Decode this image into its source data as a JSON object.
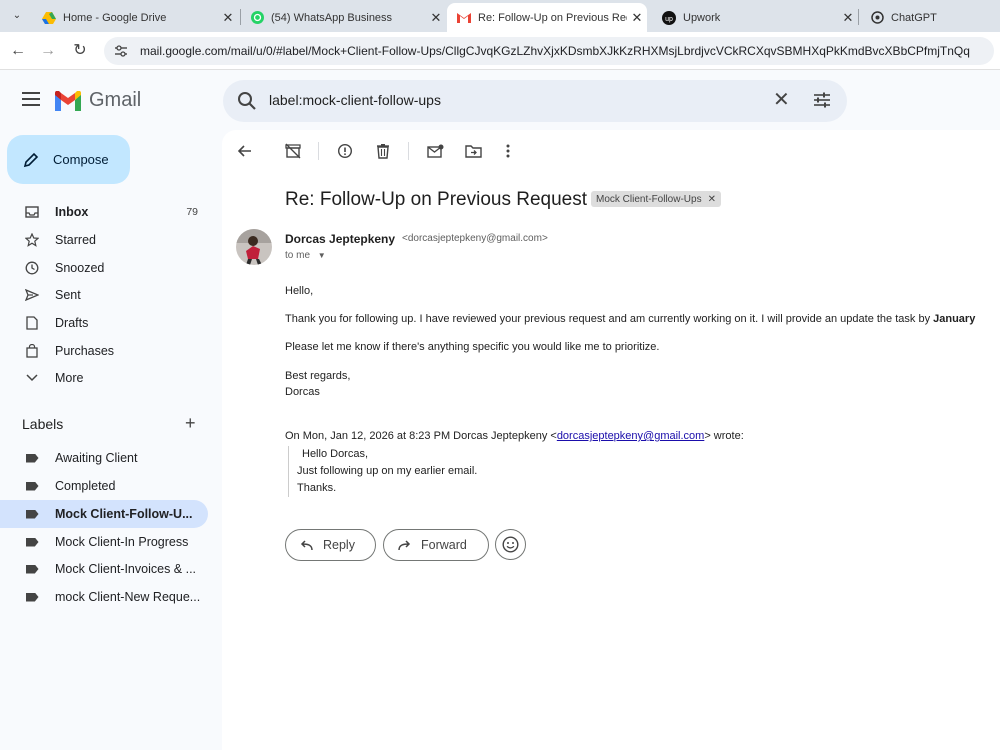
{
  "browser": {
    "tabs": [
      {
        "title": "Home - Google Drive",
        "icon": "google-drive-icon"
      },
      {
        "title": "(54) WhatsApp Business",
        "icon": "whatsapp-icon"
      },
      {
        "title": "Re: Follow-Up on Previous Reque",
        "icon": "gmail-icon",
        "active": true
      },
      {
        "title": "Upwork",
        "icon": "upwork-icon"
      },
      {
        "title": "ChatGPT",
        "icon": "chatgpt-icon"
      }
    ],
    "url": "mail.google.com/mail/u/0/#label/Mock+Client-Follow-Ups/CllgCJvqKGzLZhvXjxKDsmbXJkKzRHXMsjLbrdjvcVCkRCXqvSBMHXqPkKmdBvcXBbCPfmjTnQq"
  },
  "app": {
    "name": "Gmail"
  },
  "search": {
    "value": "label:mock-client-follow-ups"
  },
  "sidebar": {
    "compose_label": "Compose",
    "items": [
      {
        "label": "Inbox",
        "count": "79",
        "icon": "inbox-icon"
      },
      {
        "label": "Starred",
        "icon": "star-icon"
      },
      {
        "label": "Snoozed",
        "icon": "clock-icon"
      },
      {
        "label": "Sent",
        "icon": "send-icon"
      },
      {
        "label": "Drafts",
        "icon": "draft-icon"
      },
      {
        "label": "Purchases",
        "icon": "purchases-icon"
      },
      {
        "label": "More",
        "icon": "chevron-down-icon"
      }
    ],
    "labels_heading": "Labels",
    "labels": [
      {
        "label": "Awaiting Client"
      },
      {
        "label": "Completed"
      },
      {
        "label": "Mock Client-Follow-U...",
        "active": true
      },
      {
        "label": "Mock Client-In Progress"
      },
      {
        "label": "Mock Client-Invoices & ..."
      },
      {
        "label": "mock Client-New Reque..."
      }
    ]
  },
  "email": {
    "subject": "Re: Follow-Up on Previous Request",
    "label_chip": "Mock Client-Follow-Ups",
    "sender_name": "Dorcas Jeptepkeny",
    "sender_email": "<dorcasjeptepkeny@gmail.com>",
    "to": "to me",
    "greeting": "Hello,",
    "para1": "Thank you for following up. I have reviewed your previous request and am currently working on it. I will provide an update  the task by ",
    "para1_bold": "January",
    "para2": "Please let me know if there's anything specific you would like me to prioritize.",
    "signoff": "Best regards,",
    "signature": "Dorcas",
    "quote_intro": "On Mon, Jan 12, 2026 at 8:23 PM Dorcas Jeptepkeny <",
    "quote_email": "dorcasjeptepkeny@gmail.com",
    "quote_outro": "> wrote:",
    "quote_lines": [
      "Hello Dorcas,",
      "Just following up on my earlier email.",
      "Thanks."
    ]
  },
  "actions": {
    "reply": "Reply",
    "forward": "Forward"
  },
  "colors": {
    "compose_bg": "#c2e7ff",
    "active_label_bg": "#d3e3fd",
    "search_bg": "#e9eef6",
    "link": "#1a0dab"
  }
}
